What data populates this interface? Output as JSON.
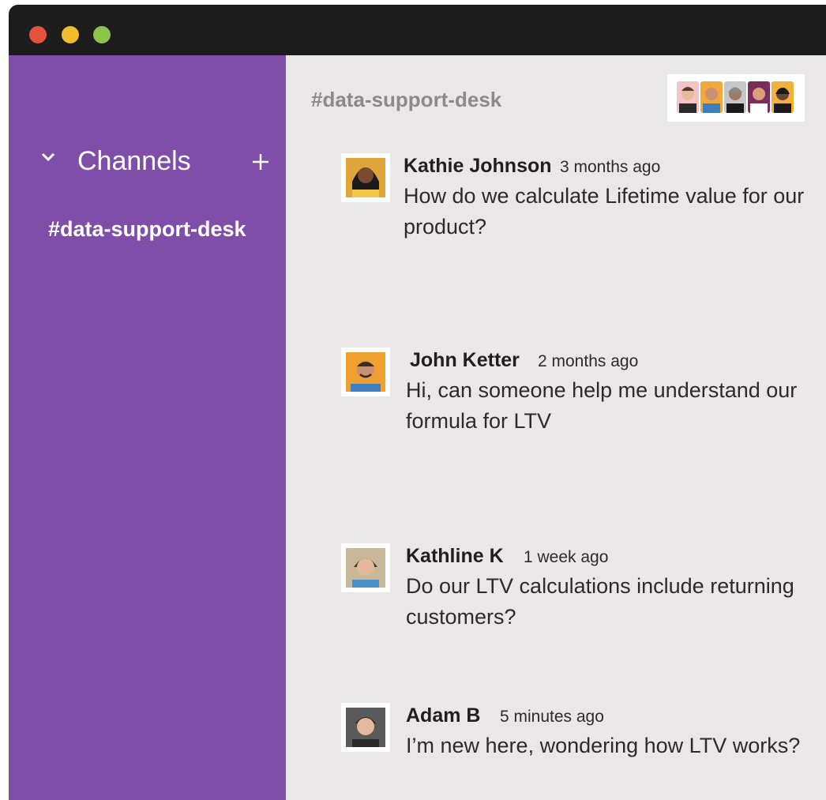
{
  "window": {
    "controls": [
      "close",
      "minimize",
      "maximize"
    ],
    "colors": {
      "close": "#e6533c",
      "minimize": "#f1bd2e",
      "maximize": "#8bc34a"
    }
  },
  "sidebar": {
    "section_title": "Channels",
    "collapse_icon": "chevron-down-icon",
    "add_icon": "plus-icon",
    "channels": [
      {
        "label": "#data-support-desk"
      }
    ],
    "color": "#7f4ea9"
  },
  "channel": {
    "name": "#data-support-desk",
    "member_count_shown": 5
  },
  "messages": [
    {
      "author": "Kathie Johnson",
      "time": "3 months ago",
      "text": "How do we calculate Lifetime value for our product?"
    },
    {
      "author": "John Ketter",
      "time": "2 months ago",
      "text": "Hi, can someone help me understand our formula for LTV"
    },
    {
      "author": "Kathline K",
      "time": "1 week ago",
      "text": "Do our LTV calculations include returning customers?"
    },
    {
      "author": "Adam B",
      "time": "5 minutes ago",
      "text": "I’m new here, wondering how LTV works?"
    }
  ]
}
